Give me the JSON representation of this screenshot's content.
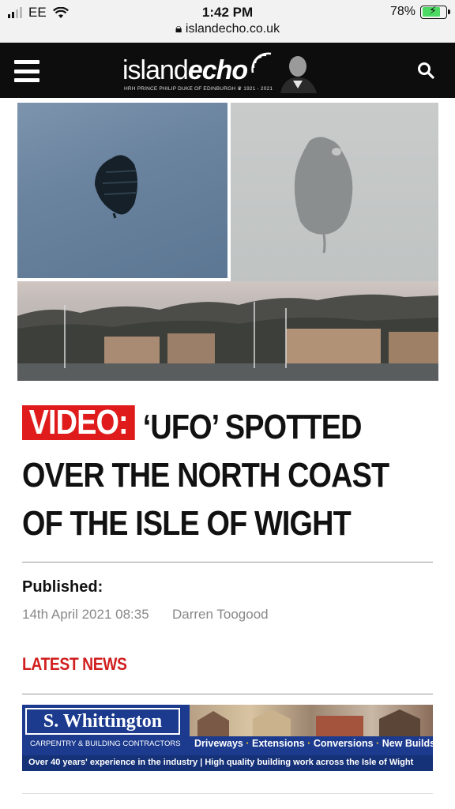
{
  "status_bar": {
    "carrier": "EE",
    "time": "1:42 PM",
    "url": "islandecho.co.uk",
    "battery_percent": "78%",
    "battery_level": 0.78
  },
  "header": {
    "logo_prefix": "island",
    "logo_suffix": "echo",
    "logo_tribute": "HRH PRINCE PHILIP DUKE OF EDINBURGH ♛ 1921 - 2021",
    "menu_icon": "hamburger-menu-icon",
    "search_icon": "search-icon"
  },
  "article": {
    "tag": "VIDEO:",
    "title": "‘UFO’ SPOTTED OVER THE NORTH COAST OF THE ISLE OF WIGHT",
    "published_label": "Published:",
    "published_date": "14th April 2021 08:35",
    "author": "Darren Toogood"
  },
  "latest_news": {
    "heading": "LATEST NEWS"
  },
  "ad": {
    "name": "S. Whittington",
    "subtitle": "CARPENTRY & BUILDING CONTRACTORS",
    "services": [
      "Driveways",
      "Extensions",
      "Conversions",
      "New Builds"
    ],
    "tagline": "Over 40 years' experience in the industry | High quality building work across the Isle of Wight"
  },
  "colors": {
    "header_bg": "#0d0d0d",
    "tag_red": "#e01b1b",
    "latest_red": "#d11f1f",
    "ad_blue": "#1c3b8f"
  }
}
